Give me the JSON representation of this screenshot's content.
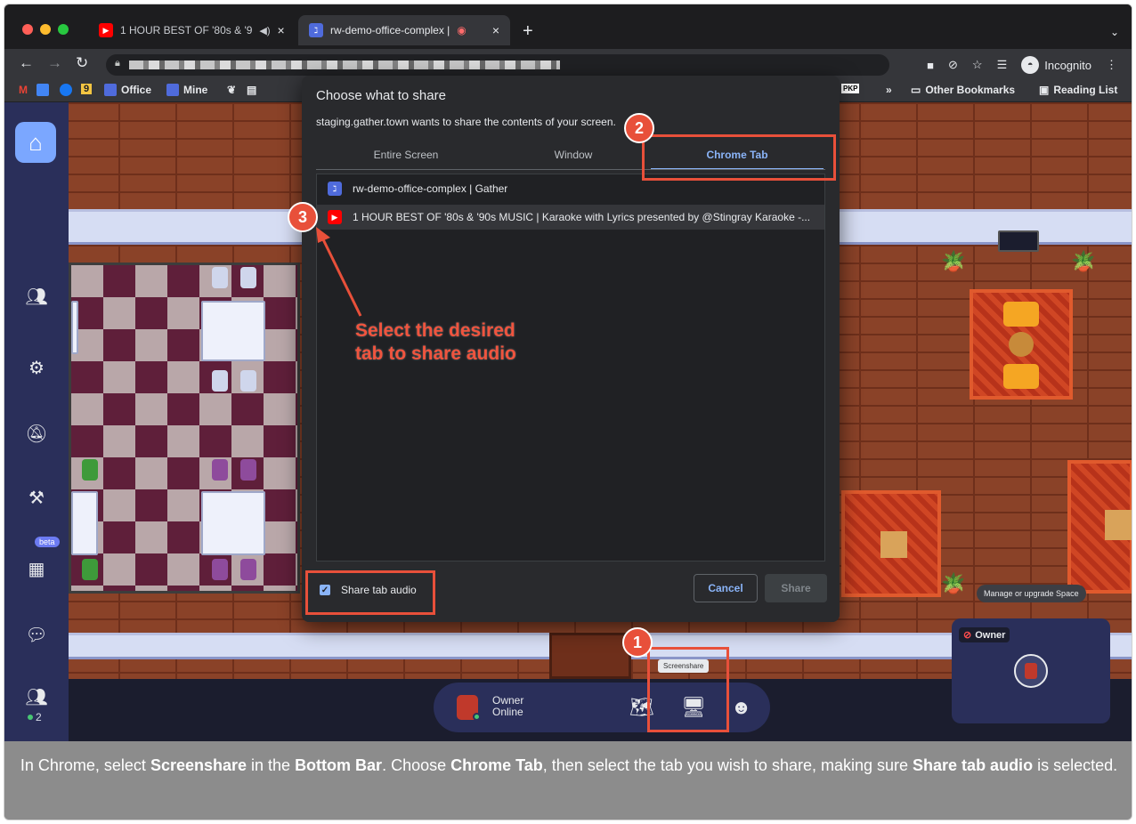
{
  "browser": {
    "tabs": [
      {
        "label": "1 HOUR BEST OF '80s & '9",
        "favicon": "youtube-icon"
      },
      {
        "label": "rw-demo-office-complex |",
        "favicon": "gather-icon"
      }
    ],
    "incognito_label": "Incognito",
    "bookmarks": [
      "Office",
      "Mine"
    ],
    "bookmarks_right": [
      "»",
      "Other Bookmarks",
      "Reading List"
    ],
    "bm_letter": "9",
    "bm_pkp": "PKP"
  },
  "dialog": {
    "title": "Choose what to share",
    "subtitle": "staging.gather.town wants to share the contents of your screen.",
    "tabs": [
      "Entire Screen",
      "Window",
      "Chrome Tab"
    ],
    "active_tab": "Chrome Tab",
    "items": [
      {
        "label": "rw-demo-office-complex | Gather",
        "icon": "gather-icon"
      },
      {
        "label": "1 HOUR BEST OF '80s & '90s MUSIC | Karaoke with Lyrics presented by @Stingray Karaoke -...",
        "icon": "youtube-icon"
      }
    ],
    "share_audio_label": "Share tab audio",
    "share_audio_checked": true,
    "cancel_label": "Cancel",
    "share_label": "Share"
  },
  "annotations": {
    "badge1": "1",
    "badge2": "2",
    "badge3": "3",
    "note_line1": "Select the desired",
    "note_line2": "tab to share audio",
    "color": "#e8503a"
  },
  "gather": {
    "sidebar_beta": "beta",
    "participant_count": "2",
    "user_name": "Owner",
    "user_status": "Online",
    "screenshare_tooltip": "Screenshare",
    "manage_tooltip": "Manage or upgrade Space",
    "owner_card_label": "Owner"
  },
  "caption": {
    "t1": "In Chrome, select ",
    "b1": "Screenshare",
    "t2": " in the ",
    "b2": "Bottom Bar",
    "t3": ". Choose ",
    "b3": "Chrome Tab",
    "t4": ", then select the tab you wish to share, making sure ",
    "b4": "Share tab audio",
    "t5": " is selected."
  }
}
